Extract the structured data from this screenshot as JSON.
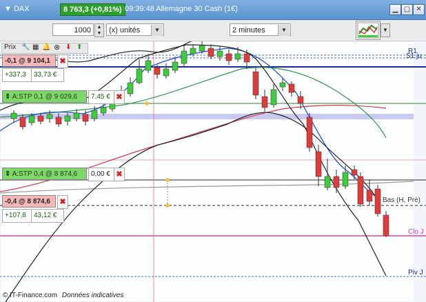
{
  "titlebar": {
    "menu_label": "▼ DAX",
    "price_change": "8 763,3 (+0,81%)",
    "time_name": "09:39:48 Allemagne 30 Cash (1€)",
    "buttons": [
      "▁",
      "▢",
      "✕"
    ]
  },
  "toolbar": {
    "quantity_value": "1000",
    "unit_select": "(x) unités",
    "interval_select": "2 minutes"
  },
  "chart_panel": {
    "label": "Prix",
    "icons": [
      "wrench-icon",
      "grid-icon",
      "bell-icon",
      "close-circle-icon",
      "arrow-down-icon",
      "arrow-up-icon"
    ]
  },
  "orders": [
    {
      "id": "o1",
      "position": "-0,1 @ 9 104,1",
      "pnl_points": "+337,3",
      "pnl_eur": "33,73 €"
    },
    {
      "id": "o2",
      "stop": "A:STP  0,1 @ 9 029,6",
      "stop_value": "7,45 €"
    },
    {
      "id": "o3",
      "stop": "A:STP  0,4 @ 8 874,6",
      "stop_value": "0,00 €"
    },
    {
      "id": "o4",
      "position": "-0,4 @ 8 874,6",
      "pnl_points": "+107,8",
      "pnl_eur": "43,12 €"
    }
  ],
  "right_labels": {
    "r1": "R1",
    "s1": "S1 ju",
    "bas": "Bas (H, Pré)",
    "clo": "Clo J",
    "piv": "Piv J"
  },
  "footer": {
    "copyright": "© IT-Finance.com",
    "note": "Données indicatives"
  },
  "colors": {
    "bull": "#3ccc3c",
    "bear": "#e03a3a",
    "title_bar": "#5a93cf",
    "price_badge": "#2e9e2e"
  }
}
